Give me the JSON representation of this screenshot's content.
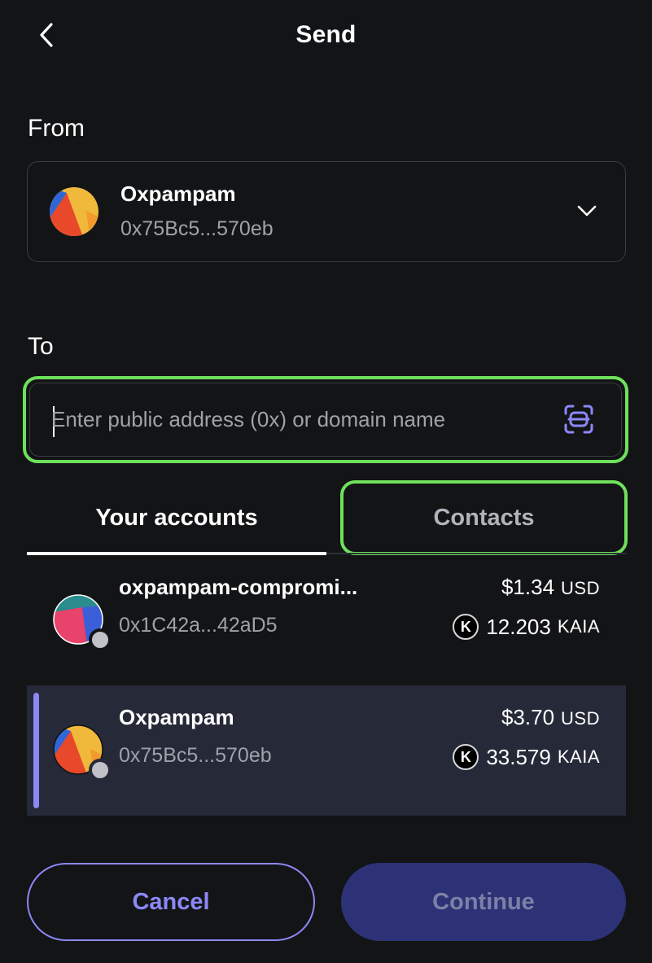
{
  "header": {
    "title": "Send",
    "back_icon": "chevron-left-icon"
  },
  "from": {
    "label": "From",
    "account_name": "Oxpampam",
    "address": "0x75Bc5...570eb",
    "dropdown_icon": "chevron-down-icon"
  },
  "to": {
    "label": "To",
    "placeholder": "Enter public address (0x) or domain name",
    "value": "",
    "scan_icon": "qr-scan-icon",
    "highlight_color": "#6ee15c"
  },
  "tabs": [
    {
      "label": "Your accounts",
      "active": true
    },
    {
      "label": "Contacts",
      "active": false
    }
  ],
  "accounts": [
    {
      "name": "oxpampam-compromi...",
      "address": "0x1C42a...42aD5",
      "fiat_value": "$1.34",
      "fiat_unit": "USD",
      "token_icon_letter": "K",
      "token_amount": "12.203",
      "token_unit": "KAIA",
      "selected": false
    },
    {
      "name": "Oxpampam",
      "address": "0x75Bc5...570eb",
      "fiat_value": "$3.70",
      "fiat_unit": "USD",
      "token_icon_letter": "K",
      "token_amount": "33.579",
      "token_unit": "KAIA",
      "selected": true
    }
  ],
  "footer": {
    "cancel_label": "Cancel",
    "continue_label": "Continue"
  },
  "colors": {
    "background": "#131416",
    "accent": "#8b88f6",
    "selected_row": "#252938",
    "continue_disabled": "#2c3275"
  }
}
